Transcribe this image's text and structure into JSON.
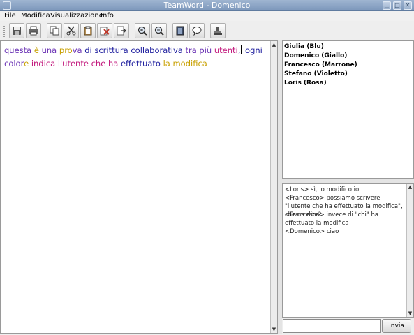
{
  "window": {
    "title": "TeamWord - Domenico"
  },
  "titlebar_buttons": [
    "minimize-icon",
    "maximize-icon",
    "close-icon"
  ],
  "menubar": {
    "items": [
      {
        "label": "File"
      },
      {
        "label": "Modifica"
      },
      {
        "label": "Visualizzazione"
      },
      {
        "label": "Info"
      }
    ]
  },
  "toolbar": {
    "buttons": [
      {
        "icon": "save-icon"
      },
      {
        "icon": "print-icon"
      },
      {
        "icon": "copy-icon"
      },
      {
        "icon": "cut-icon"
      },
      {
        "icon": "paste-icon"
      },
      {
        "icon": "delete-icon"
      },
      {
        "icon": "export-icon"
      },
      {
        "icon": "zoom-in-icon"
      },
      {
        "icon": "zoom-out-icon"
      },
      {
        "icon": "notebook-icon"
      },
      {
        "icon": "chat-bubble-icon"
      },
      {
        "icon": "stamp-icon"
      }
    ]
  },
  "editor": {
    "segments": [
      {
        "text": "questa ",
        "color": "#6a32b4"
      },
      {
        "text": "è ",
        "color": "#c8a000"
      },
      {
        "text": "una ",
        "color": "#6a32b4"
      },
      {
        "text": "pro",
        "color": "#c8a000"
      },
      {
        "text": "va ",
        "color": "#6a32b4"
      },
      {
        "text": "di scrittura collaborativa ",
        "color": "#1e1e9e"
      },
      {
        "text": "tra più ",
        "color": "#6a32b4"
      },
      {
        "text": "utenti",
        "color": "#c2187c"
      },
      {
        "text": ",",
        "color": "#1e1e9e"
      },
      {
        "text": " ogni",
        "color": "#1e1e9e"
      },
      {
        "text": "color",
        "color": "#6a32b4"
      },
      {
        "text": "e ",
        "color": "#c8a000"
      },
      {
        "text": "indica ",
        "color": "#c2187c"
      },
      {
        "text": "l'utente che ",
        "color": "#c2187c"
      },
      {
        "text": "ha ",
        "color": "#c2187c"
      },
      {
        "text": "effettuato ",
        "color": "#1e1e9e"
      },
      {
        "text": "la modifica",
        "color": "#c8a000"
      }
    ]
  },
  "users": [
    {
      "label": "Giulia (Blu)"
    },
    {
      "label": "Domenico (Giallo)"
    },
    {
      "label": "Francesco (Marrone)"
    },
    {
      "label": "Stefano (Violetto)"
    },
    {
      "label": "Loris (Rosa)"
    }
  ],
  "chat": {
    "messages": [
      {
        "text": "<Loris> sì, lo modifico io"
      },
      {
        "text": "<Francesco> possiamo scrivere \"l'utente che ha effettuato la modifica\", che ne dite?"
      },
      {
        "text": "<Francesco> invece di \"chi\" ha effettuato la modifica"
      },
      {
        "text": "<Domenico> ciao"
      }
    ],
    "input_value": "",
    "send_label": "Invia"
  }
}
